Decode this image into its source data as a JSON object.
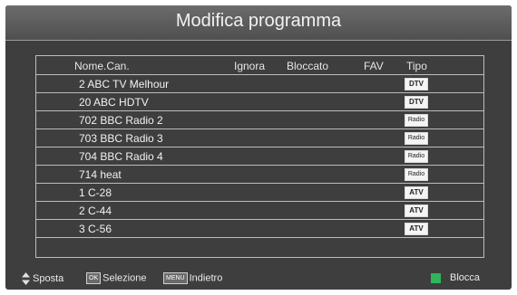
{
  "header": {
    "title": "Modifica programma"
  },
  "columns": {
    "name": "Nome.Can.",
    "skip": "Ignora",
    "lock": "Bloccato",
    "fav": "FAV",
    "type": "Tipo"
  },
  "channels": [
    {
      "name": "2  ABC  TV Melhour",
      "type": "DTV"
    },
    {
      "name": "20  ABC HDTV",
      "type": "DTV"
    },
    {
      "name": "702  BBC Radio 2",
      "type": "Radio"
    },
    {
      "name": "703  BBC Radio 3",
      "type": "Radio"
    },
    {
      "name": "704  BBC Radio 4",
      "type": "Radio"
    },
    {
      "name": "714  heat",
      "type": "Radio"
    },
    {
      "name": "1  C-28",
      "type": "ATV"
    },
    {
      "name": "2  C-44",
      "type": "ATV"
    },
    {
      "name": "3  C-56",
      "type": "ATV"
    }
  ],
  "footer": {
    "move_label": "Sposta",
    "ok_key": "OK",
    "select_label": "Selezione",
    "menu_key": "MENU",
    "back_label": "Indietro",
    "lock_label": "Blocca",
    "lock_key_color": "#2fb55a"
  }
}
